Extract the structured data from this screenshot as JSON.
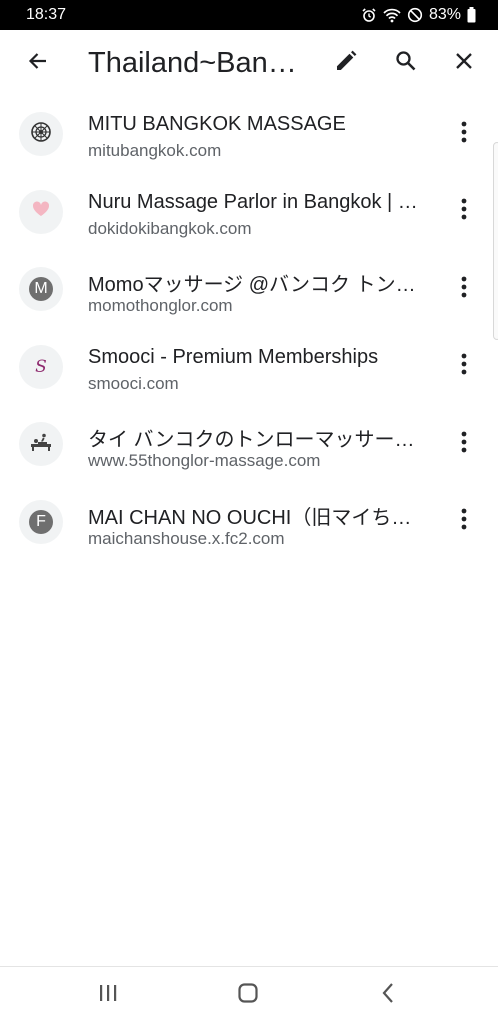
{
  "status_bar": {
    "time": "18:37",
    "battery_percent": "83%",
    "icons": [
      "alarm-icon",
      "wifi-icon",
      "do-not-disturb-icon",
      "battery-icon"
    ]
  },
  "toolbar": {
    "title": "Thailand~Ban…",
    "icons": [
      "back-arrow-icon",
      "edit-pencil-icon",
      "search-icon",
      "close-icon"
    ]
  },
  "bookmarks": [
    {
      "title": "MITU BANGKOK MASSAGE",
      "url": "mitubangkok.com",
      "favicon": "emblem-icon"
    },
    {
      "title": "Nuru Massage Parlor in Bangkok | …",
      "url": "dokidokibangkok.com",
      "favicon": "heart-icon"
    },
    {
      "title": "Momoマッサージ @バンコク トン…",
      "url": "momothonglor.com",
      "favicon": "letter-badge-icon",
      "letter": "M"
    },
    {
      "title": "Smooci - Premium Memberships",
      "url": "smooci.com",
      "favicon": "script-s-icon",
      "letter": "S"
    },
    {
      "title": "タイ バンコクのトンローマッサー…",
      "url": "www.55thonglor-massage.com",
      "favicon": "massage-bed-icon"
    },
    {
      "title": "MAI CHAN NO OUCHI（旧マイちゃ…",
      "url": "maichanshouse.x.fc2.com",
      "favicon": "letter-badge-icon",
      "letter": "F"
    }
  ],
  "nav_bar": {
    "icons": [
      "recent-apps-icon",
      "home-icon",
      "back-icon"
    ]
  },
  "colors": {
    "status_bar_bg": "#000000",
    "favicon_bg": "#f1f3f4",
    "heart": "#f4b6c2",
    "smooci_accent": "#8e2a6e",
    "text_primary": "#202124",
    "text_secondary": "#5f6368"
  }
}
